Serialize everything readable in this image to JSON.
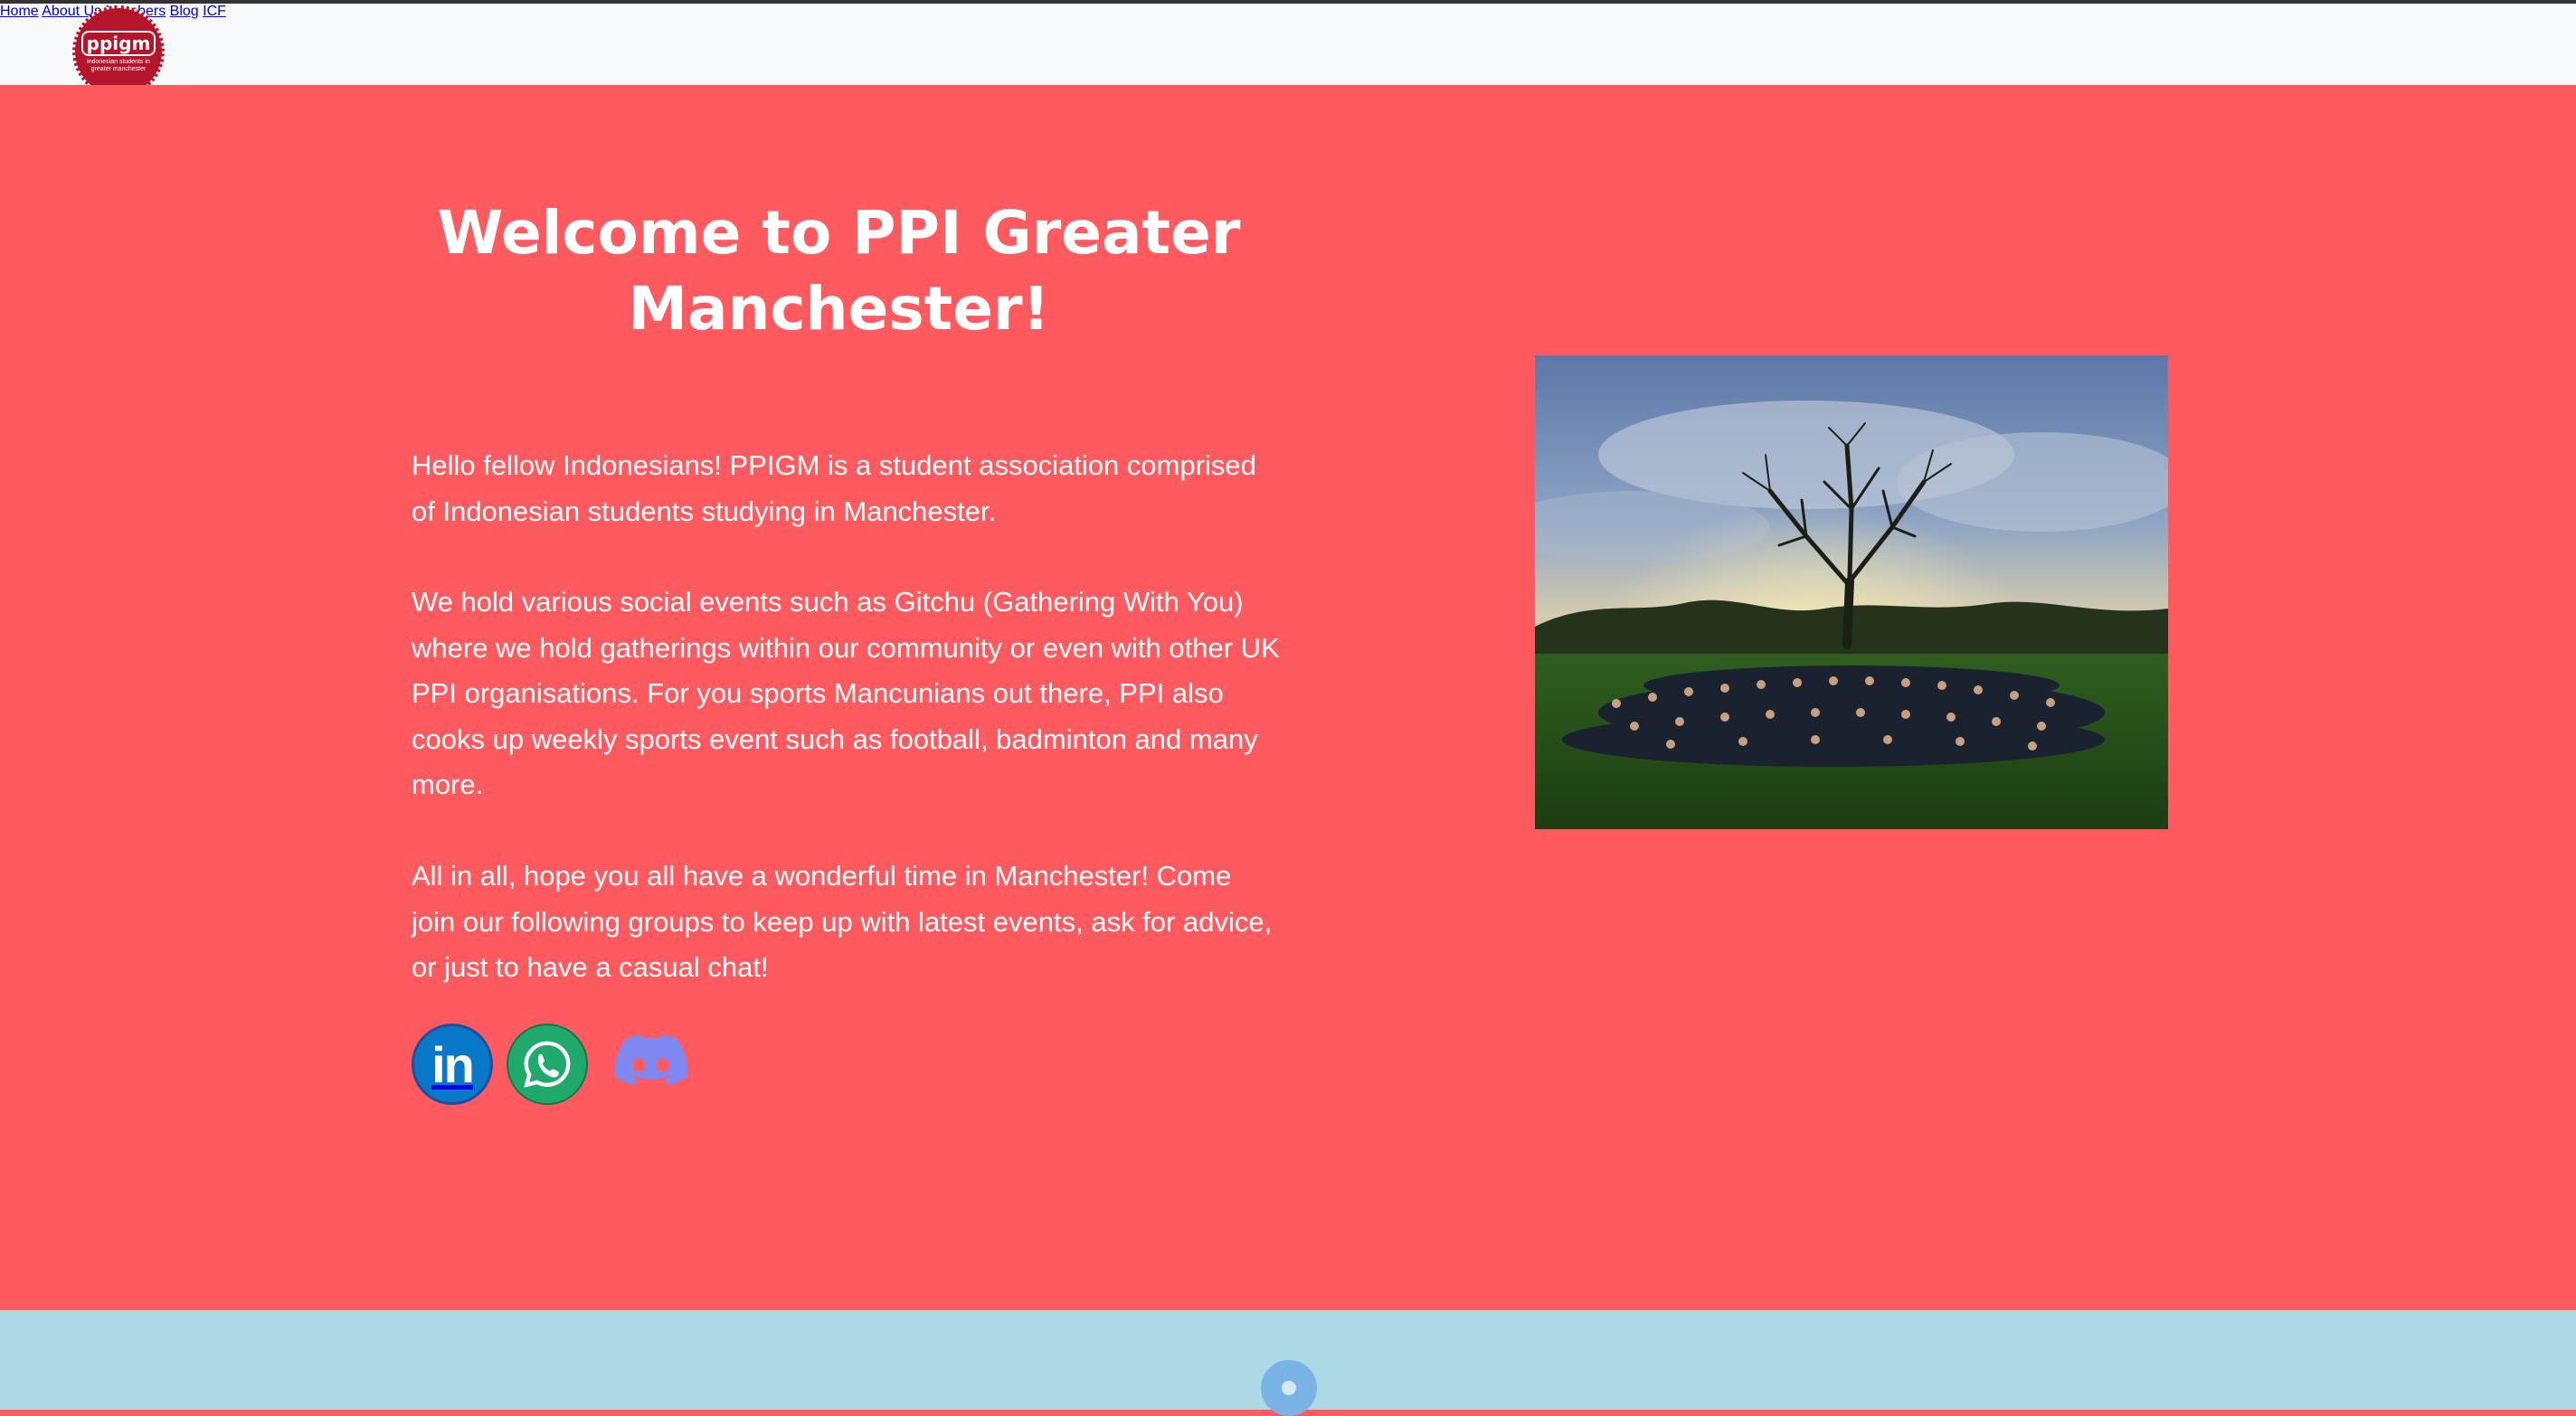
{
  "brand": {
    "logo_name": "ppigm",
    "logo_tagline": "indonesian students in greater manchester",
    "logo_color": "#b5152b"
  },
  "nav": {
    "items": [
      {
        "label": "Home"
      },
      {
        "label": "About Us"
      },
      {
        "label": "Members"
      },
      {
        "label": "Blog"
      },
      {
        "label": "ICF"
      }
    ]
  },
  "hero": {
    "title": "Welcome to PPI Greater Manchester!",
    "paragraphs": [
      "Hello fellow Indonesians! PPIGM is a student association comprised of Indonesian students studying in Manchester.",
      "We hold various social events such as Gitchu (Gathering With You) where we hold gatherings within our community or even with other UK PPI organisations. For you sports Mancunians out there, PPI also cooks up weekly sports event such as football, badminton and many more.",
      "All in all, hope you all have a wonderful time in Manchester! Come join our following groups to keep up with latest events, ask for advice, or just to have a casual chat!"
    ],
    "background_color": "#ff5a5f"
  },
  "social": [
    {
      "icon": "linkedin-icon",
      "label": "in"
    },
    {
      "icon": "whatsapp-icon"
    },
    {
      "icon": "discord-icon"
    }
  ],
  "photo": {
    "icon": "group-photo"
  },
  "section2": {
    "background_color": "#add8e6"
  }
}
